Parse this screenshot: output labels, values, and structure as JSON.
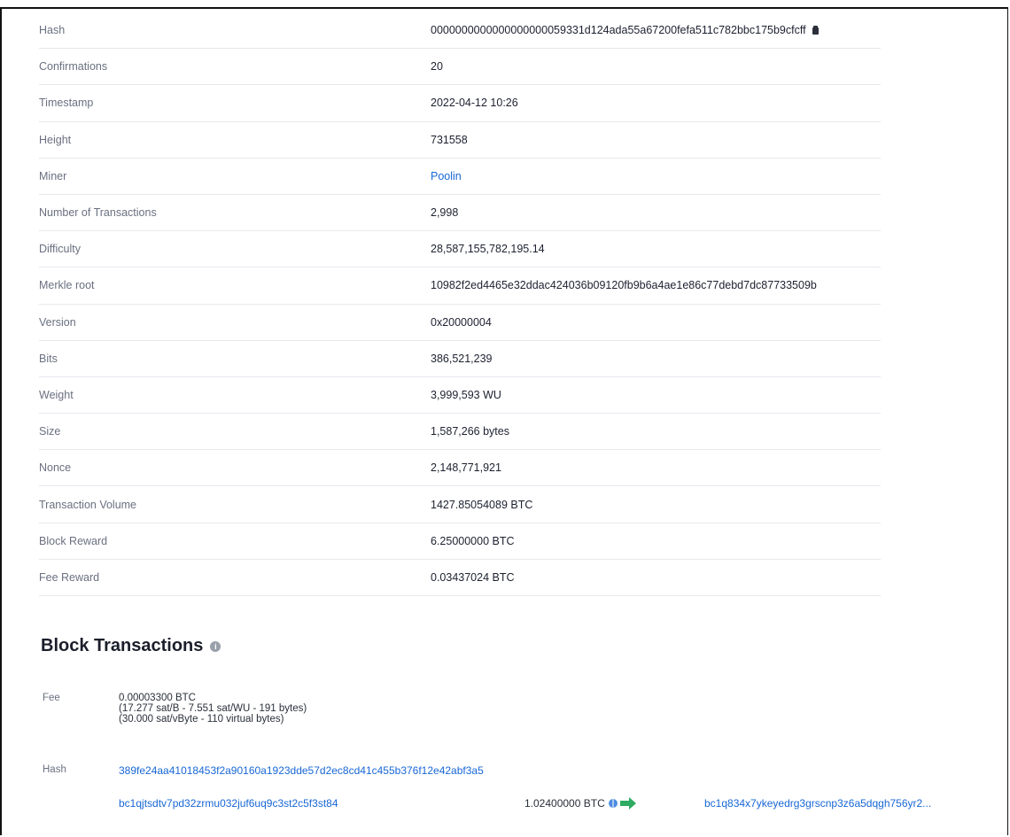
{
  "block_details": [
    {
      "label": "Hash",
      "value": "0000000000000000000059331d124ada55a67200fefa511c782bbc175b9cfcff",
      "link": false,
      "copy": true
    },
    {
      "label": "Confirmations",
      "value": "20",
      "link": false
    },
    {
      "label": "Timestamp",
      "value": "2022-04-12 10:26",
      "link": false
    },
    {
      "label": "Height",
      "value": "731558",
      "link": false
    },
    {
      "label": "Miner",
      "value": "Poolin",
      "link": true
    },
    {
      "label": "Number of Transactions",
      "value": "2,998",
      "link": false
    },
    {
      "label": "Difficulty",
      "value": "28,587,155,782,195.14",
      "link": false
    },
    {
      "label": "Merkle root",
      "value": "10982f2ed4465e32ddac424036b09120fb9b6a4ae1e86c77debd7dc87733509b",
      "link": false
    },
    {
      "label": "Version",
      "value": "0x20000004",
      "link": false
    },
    {
      "label": "Bits",
      "value": "386,521,239",
      "link": false
    },
    {
      "label": "Weight",
      "value": "3,999,593 WU",
      "link": false
    },
    {
      "label": "Size",
      "value": "1,587,266 bytes",
      "link": false
    },
    {
      "label": "Nonce",
      "value": "2,148,771,921",
      "link": false
    },
    {
      "label": "Transaction Volume",
      "value": "1427.85054089 BTC",
      "link": false
    },
    {
      "label": "Block Reward",
      "value": "6.25000000 BTC",
      "link": false
    },
    {
      "label": "Fee Reward",
      "value": "0.03437024 BTC",
      "link": false
    }
  ],
  "transactions": {
    "title": "Block Transactions",
    "info_icon": "info-icon",
    "fee_label": "Fee",
    "fee_lines": [
      "0.00003300 BTC",
      "(17.277 sat/B - 7.551 sat/WU - 191 bytes)",
      "(30.000 sat/vByte - 110 virtual bytes)"
    ],
    "hash_label": "Hash",
    "hash": "389fe24aa41018453f2a90160a1923dde57d2ec8cd41c455b376f12e42abf3a5",
    "input_address": "bc1qjtsdtv7pd32zrmu032juf6uq9c3st2c5f3st84",
    "amount": "1.02400000 BTC",
    "output_address": "bc1q834x7ykeyedrg3grscnp3z6a5dqgh756yr2..."
  },
  "colors": {
    "link": "#1867d6",
    "arrow": "#2eaa62",
    "border": "#e6e8ec"
  }
}
